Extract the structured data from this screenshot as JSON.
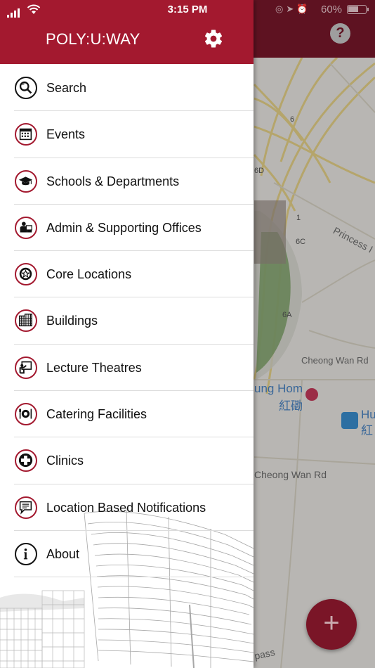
{
  "status_bar": {
    "time": "3:15 PM",
    "battery_percent": "60%",
    "battery_level": 0.6
  },
  "app_bar": {
    "help_label": "?"
  },
  "drawer": {
    "title": "POLY:U:WAY",
    "settings_icon": "gear-icon",
    "menu": [
      {
        "label": "Search",
        "icon": "search-icon"
      },
      {
        "label": "Events",
        "icon": "calendar-icon"
      },
      {
        "label": "Schools & Departments",
        "icon": "graduation-cap-icon"
      },
      {
        "label": "Admin & Supporting Offices",
        "icon": "office-worker-icon"
      },
      {
        "label": "Core Locations",
        "icon": "star-badge-icon"
      },
      {
        "label": "Buildings",
        "icon": "building-icon"
      },
      {
        "label": "Lecture Theatres",
        "icon": "presentation-board-icon"
      },
      {
        "label": "Catering Facilities",
        "icon": "plate-cutlery-icon"
      },
      {
        "label": "Clinics",
        "icon": "medical-cross-icon"
      },
      {
        "label": "Location Based Notifications",
        "icon": "message-icon"
      },
      {
        "label": "About",
        "icon": "info-icon"
      }
    ]
  },
  "map": {
    "labels": {
      "princess": "Princess I",
      "cheong_wan_1": "Cheong Wan Rd",
      "cheong_wan_2": "Cheong Wan Rd",
      "hung_hom_en": "ung Hom",
      "hung_hom_zh": "紅磡",
      "hu_en": "Hu",
      "hu_zh": "紅",
      "bypass": "pass",
      "road_6": "6",
      "road_6d": "6D",
      "road_6c": "6C",
      "road_6a": "6A",
      "road_1": "1"
    }
  },
  "fab": {
    "label": "+"
  },
  "colors": {
    "brand": "#a3192f",
    "app_bar_dimmed": "#5e1221"
  }
}
